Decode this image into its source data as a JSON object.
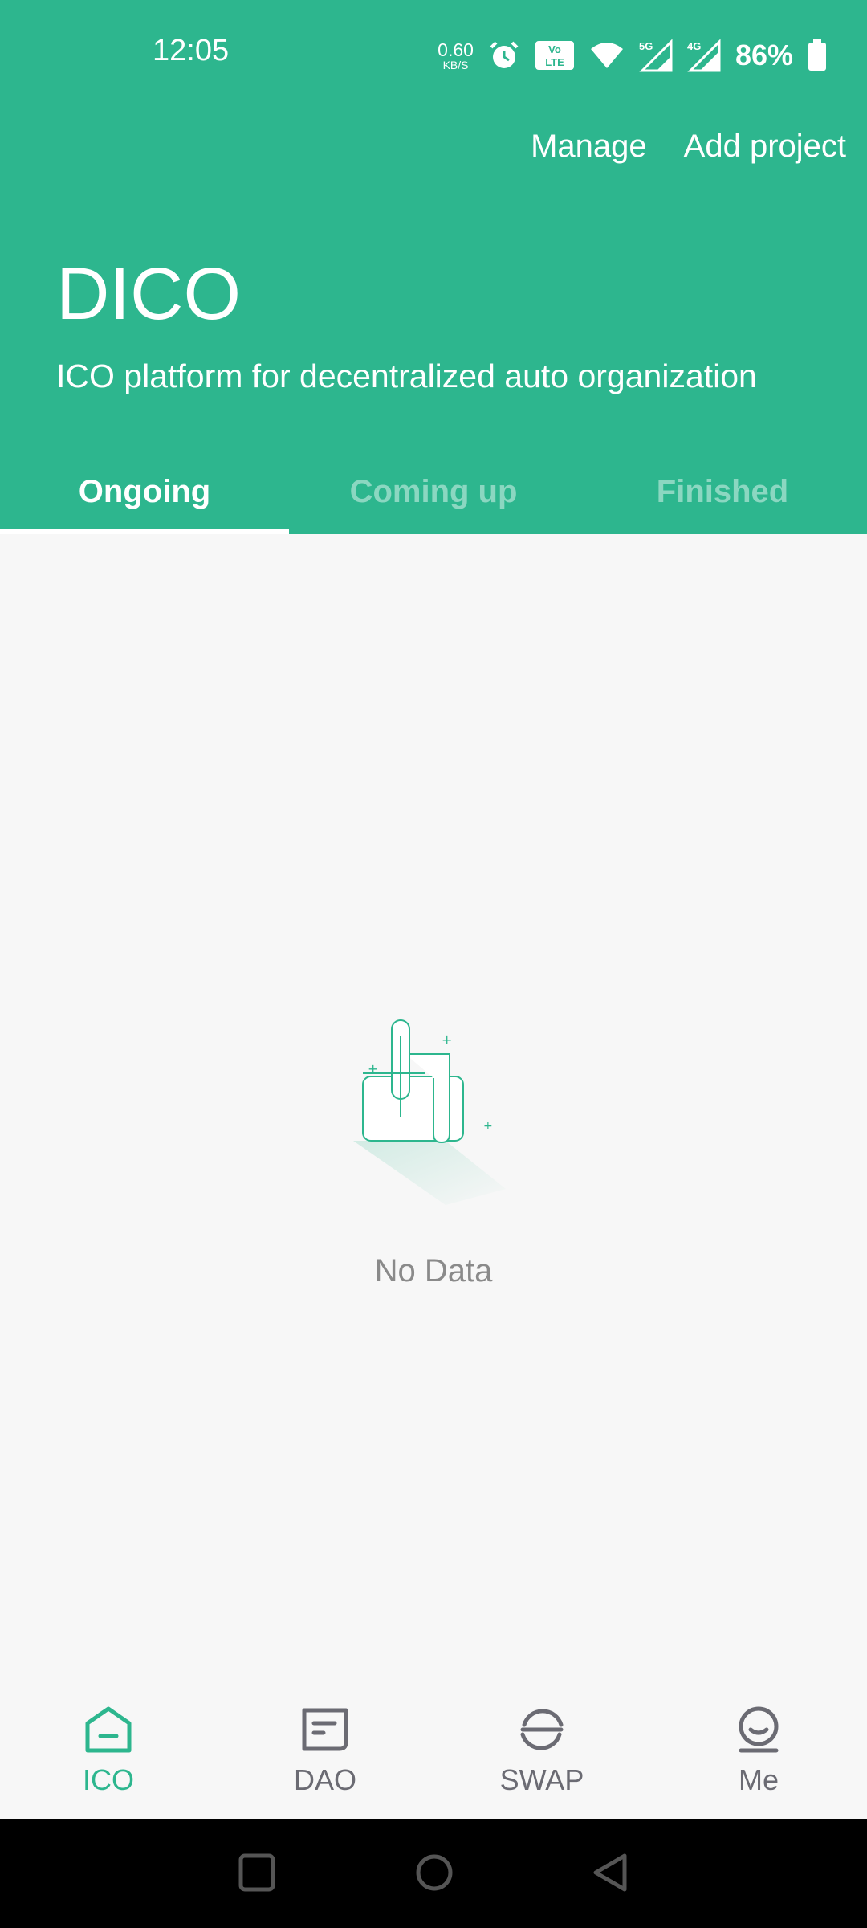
{
  "status_bar": {
    "time": "12:05",
    "net_speed_value": "0.60",
    "net_speed_unit": "KB/S",
    "battery": "86%",
    "icons": [
      "alarm-icon",
      "volte-icon",
      "wifi-icon",
      "signal-5g-icon",
      "signal-4g-icon",
      "battery-icon"
    ]
  },
  "header": {
    "manage_label": "Manage",
    "add_project_label": "Add project",
    "title": "DICO",
    "subtitle": "ICO platform for decentralized auto organization"
  },
  "tabs": [
    {
      "label": "Ongoing",
      "active": true
    },
    {
      "label": "Coming up",
      "active": false
    },
    {
      "label": "Finished",
      "active": false
    }
  ],
  "empty_state": {
    "text": "No Data",
    "icon": "empty-document-icon"
  },
  "bottom_nav": [
    {
      "label": "ICO",
      "icon": "ico-home-icon",
      "active": true
    },
    {
      "label": "DAO",
      "icon": "dao-message-icon",
      "active": false
    },
    {
      "label": "SWAP",
      "icon": "swap-icon",
      "active": false
    },
    {
      "label": "Me",
      "icon": "profile-icon",
      "active": false
    }
  ],
  "colors": {
    "brand": "#2db68e",
    "background": "#f7f7f7",
    "nav_inactive": "#6b6b73"
  }
}
